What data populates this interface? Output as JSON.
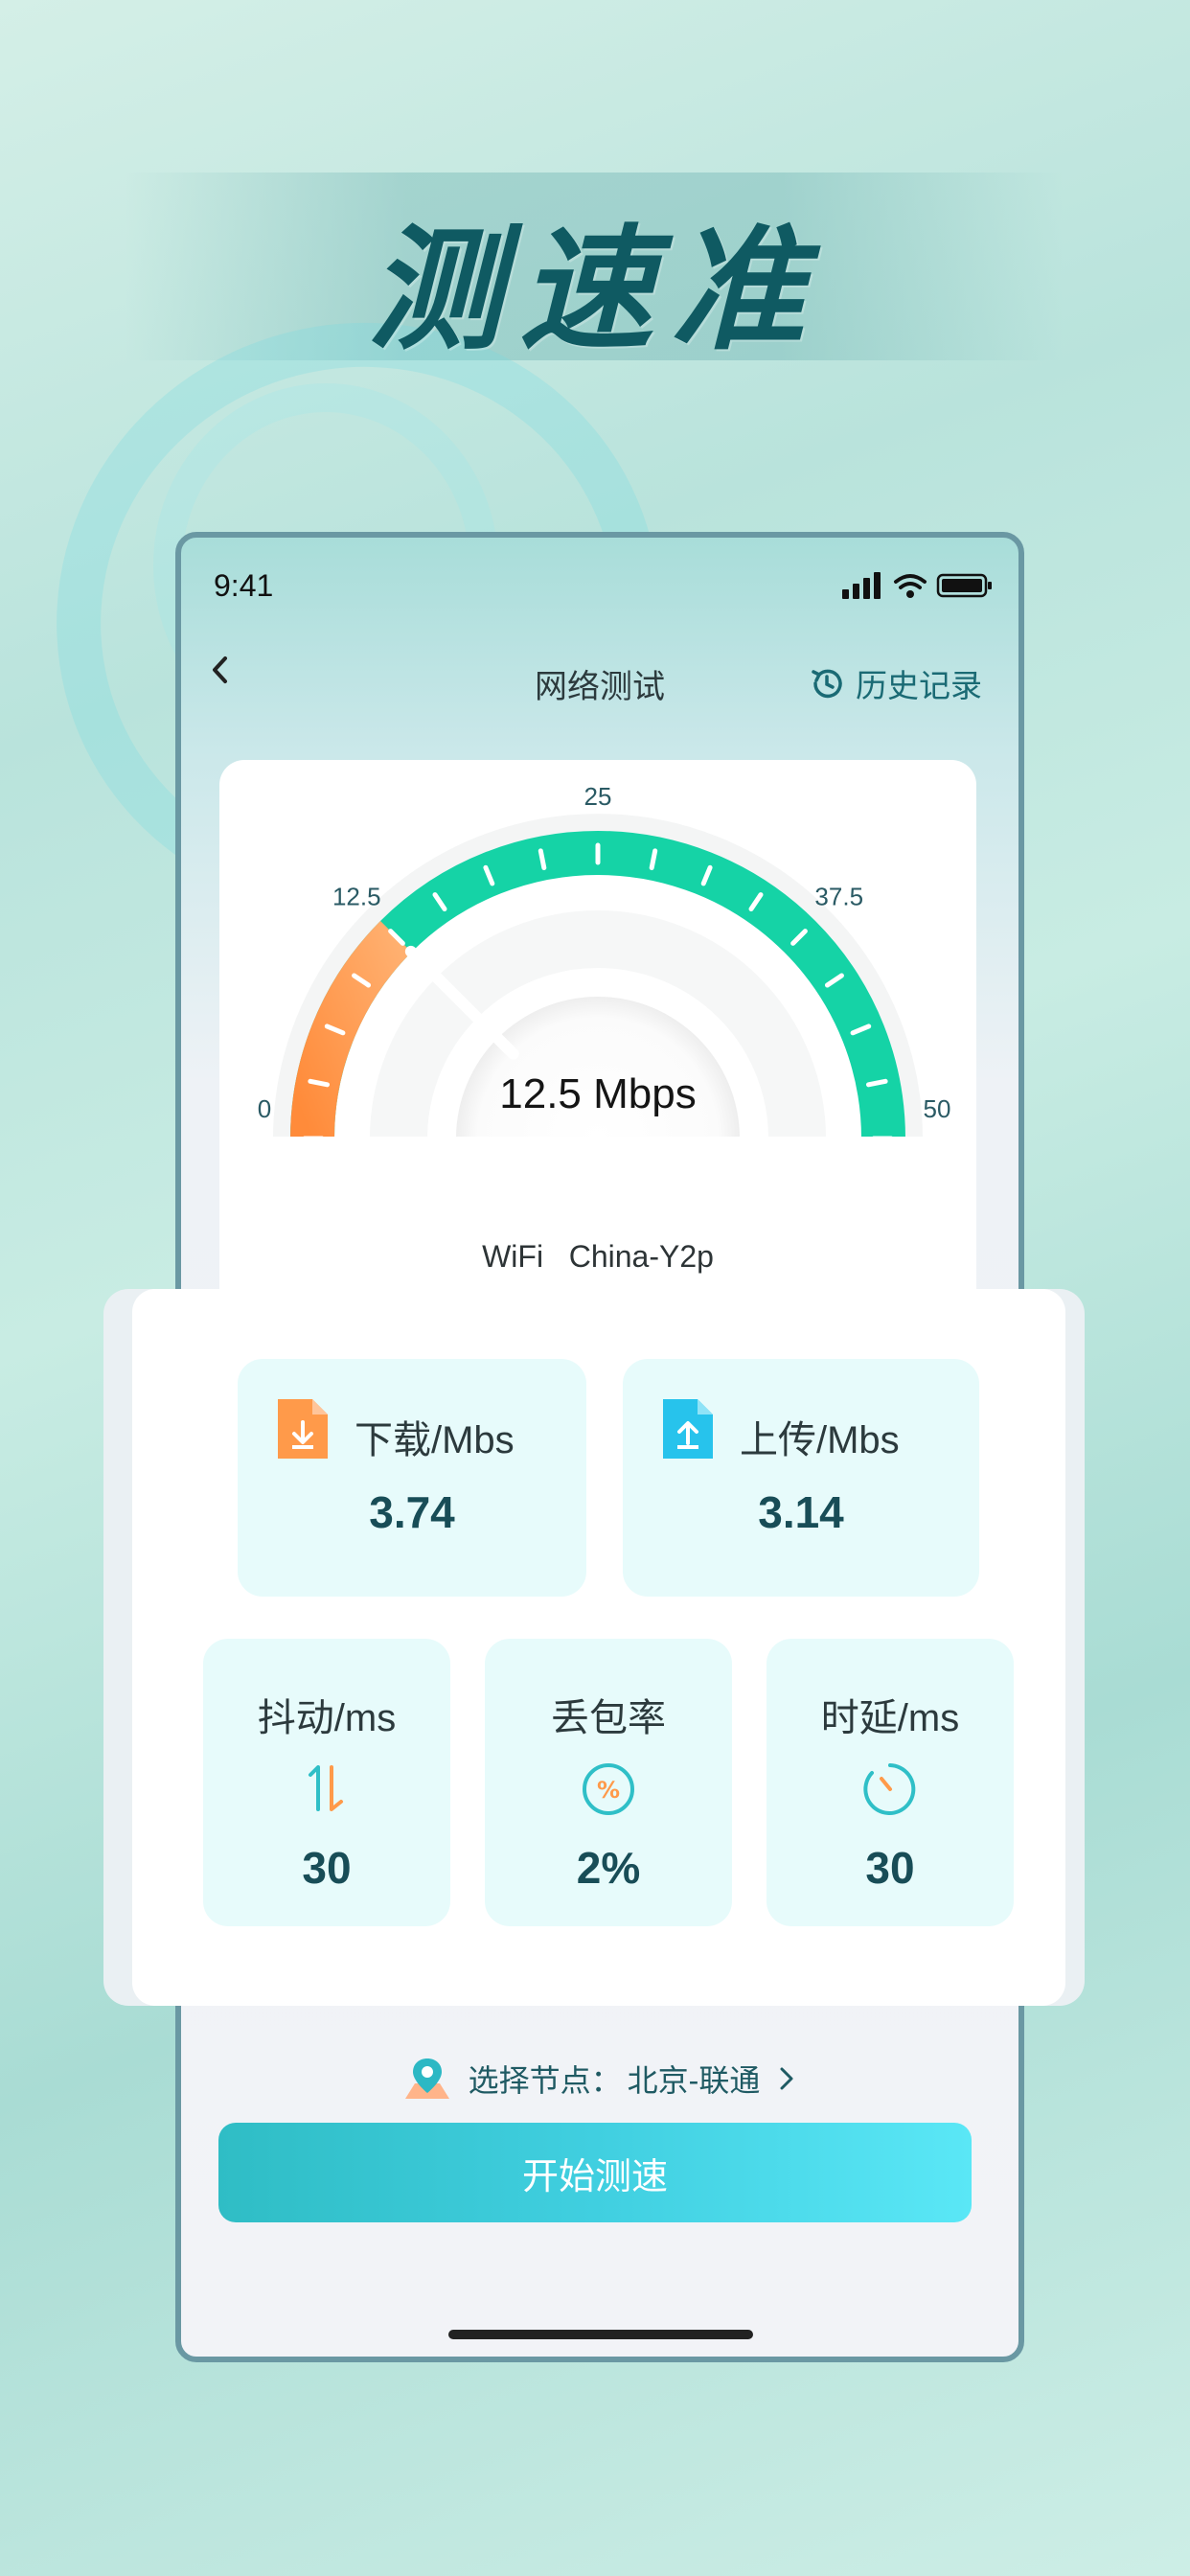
{
  "headline": "测速准",
  "status_bar": {
    "time": "9:41"
  },
  "nav": {
    "title": "网络测试",
    "history_label": "历史记录"
  },
  "gauge": {
    "value_text": "12.5 Mbps",
    "value": 12.5,
    "min": 0,
    "max": 50,
    "tick_labels": [
      "0",
      "12.5",
      "25",
      "37.5",
      "50"
    ]
  },
  "network": {
    "type": "WiFi",
    "name": "China-Y2p"
  },
  "stats": {
    "download": {
      "label": "下载/Mbs",
      "value": "3.74"
    },
    "upload": {
      "label": "上传/Mbs",
      "value": "3.14"
    },
    "jitter": {
      "label": "抖动/ms",
      "value": "30"
    },
    "packet_loss": {
      "label": "丢包率",
      "value": "2%"
    },
    "latency": {
      "label": "时延/ms",
      "value": "30"
    }
  },
  "node": {
    "prefix": "选择节点：",
    "value": "北京-联通"
  },
  "start_button": "开始测速",
  "colors": {
    "accent": "#15d3a6",
    "orange": "#ff8f3d",
    "button": "#3cc8d6",
    "dark_text": "#184d57"
  }
}
